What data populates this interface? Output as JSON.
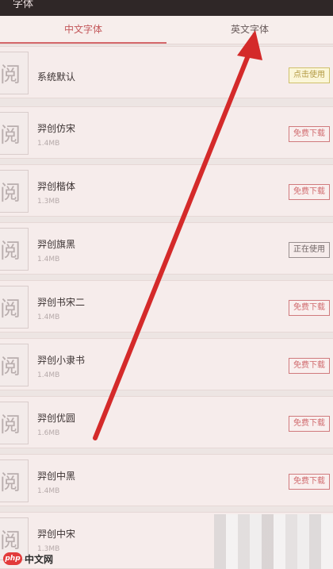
{
  "topbar": {
    "title": "字体"
  },
  "tabs": [
    {
      "label": "中文字体",
      "active": true
    },
    {
      "label": "英文字体",
      "active": false
    }
  ],
  "fonts": [
    {
      "thumb": "阅",
      "name": "系统默认",
      "size": "",
      "action": "点击使用",
      "state": "use"
    },
    {
      "thumb": "阅",
      "name": "羿创仿宋",
      "size": "1.4MB",
      "action": "免费下载",
      "state": "download"
    },
    {
      "thumb": "阅",
      "name": "羿创楷体",
      "size": "1.3MB",
      "action": "免费下载",
      "state": "download"
    },
    {
      "thumb": "阅",
      "name": "羿创旗黑",
      "size": "1.4MB",
      "action": "正在使用",
      "state": "using"
    },
    {
      "thumb": "阅",
      "name": "羿创书宋二",
      "size": "1.4MB",
      "action": "免费下载",
      "state": "download"
    },
    {
      "thumb": "阅",
      "name": "羿创小隶书",
      "size": "1.4MB",
      "action": "免费下载",
      "state": "download"
    },
    {
      "thumb": "阅",
      "name": "羿创优圆",
      "size": "1.6MB",
      "action": "免费下载",
      "state": "download"
    },
    {
      "thumb": "阅",
      "name": "羿创中黑",
      "size": "1.4MB",
      "action": "免费下载",
      "state": "download"
    },
    {
      "thumb": "阅",
      "name": "羿创中宋",
      "size": "1.3MB",
      "action": "",
      "state": "hidden"
    }
  ],
  "watermark": {
    "logo": "php",
    "text": "中文网"
  },
  "colors": {
    "accent": "#d4686b",
    "arrow": "#d42a2a",
    "use_button": "#cfc06b",
    "using_button": "#9a9090"
  },
  "icons": {
    "thumbnail": "font-preview-icon",
    "arrow": "annotation-arrow-icon"
  }
}
